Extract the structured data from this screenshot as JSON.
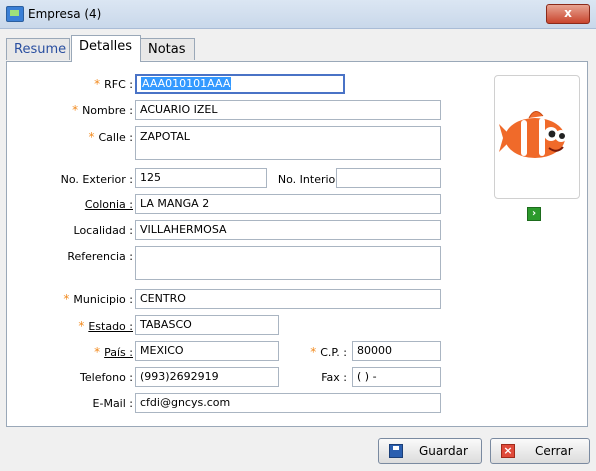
{
  "window": {
    "title": "Empresa (4)",
    "close_glyph": "x"
  },
  "tabs": [
    {
      "label": "Resume"
    },
    {
      "label": "Detalles"
    },
    {
      "label": "Notas"
    }
  ],
  "form": {
    "rfc": {
      "label": "RFC :",
      "value": "AAA010101AAA"
    },
    "nombre": {
      "label": "Nombre :",
      "value": "ACUARIO IZEL"
    },
    "calle": {
      "label": "Calle :",
      "value": "ZAPOTAL"
    },
    "no_exterior": {
      "label": "No. Exterior :",
      "value": "125"
    },
    "no_interior": {
      "label": "No. Interior :",
      "value": ""
    },
    "colonia": {
      "label": "Colonia :",
      "value": "LA MANGA 2"
    },
    "localidad": {
      "label": "Localidad :",
      "value": "VILLAHERMOSA"
    },
    "referencia": {
      "label": "Referencia :",
      "value": ""
    },
    "municipio": {
      "label": "Municipio :",
      "value": "CENTRO"
    },
    "estado": {
      "label": "Estado :",
      "value": "TABASCO"
    },
    "pais": {
      "label": "País :",
      "value": "MEXICO"
    },
    "cp": {
      "label": "C.P. :",
      "value": "80000"
    },
    "telefono": {
      "label": "Telefono :",
      "value": "(993)2692919"
    },
    "fax": {
      "label": "Fax :",
      "value": "(  )  -"
    },
    "email": {
      "label": "E-Mail :",
      "value": "cfdi@gncys.com"
    }
  },
  "photo": {
    "icon": "clownfish-logo-icon"
  },
  "buttons": {
    "save": {
      "label": "Guardar",
      "icon": "save-icon"
    },
    "close": {
      "label": "Cerrar",
      "icon": "close-icon"
    }
  },
  "colors": {
    "required_marker": "#f28a1e",
    "focus_border": "#4a73c6",
    "selection": "#3399ff"
  }
}
